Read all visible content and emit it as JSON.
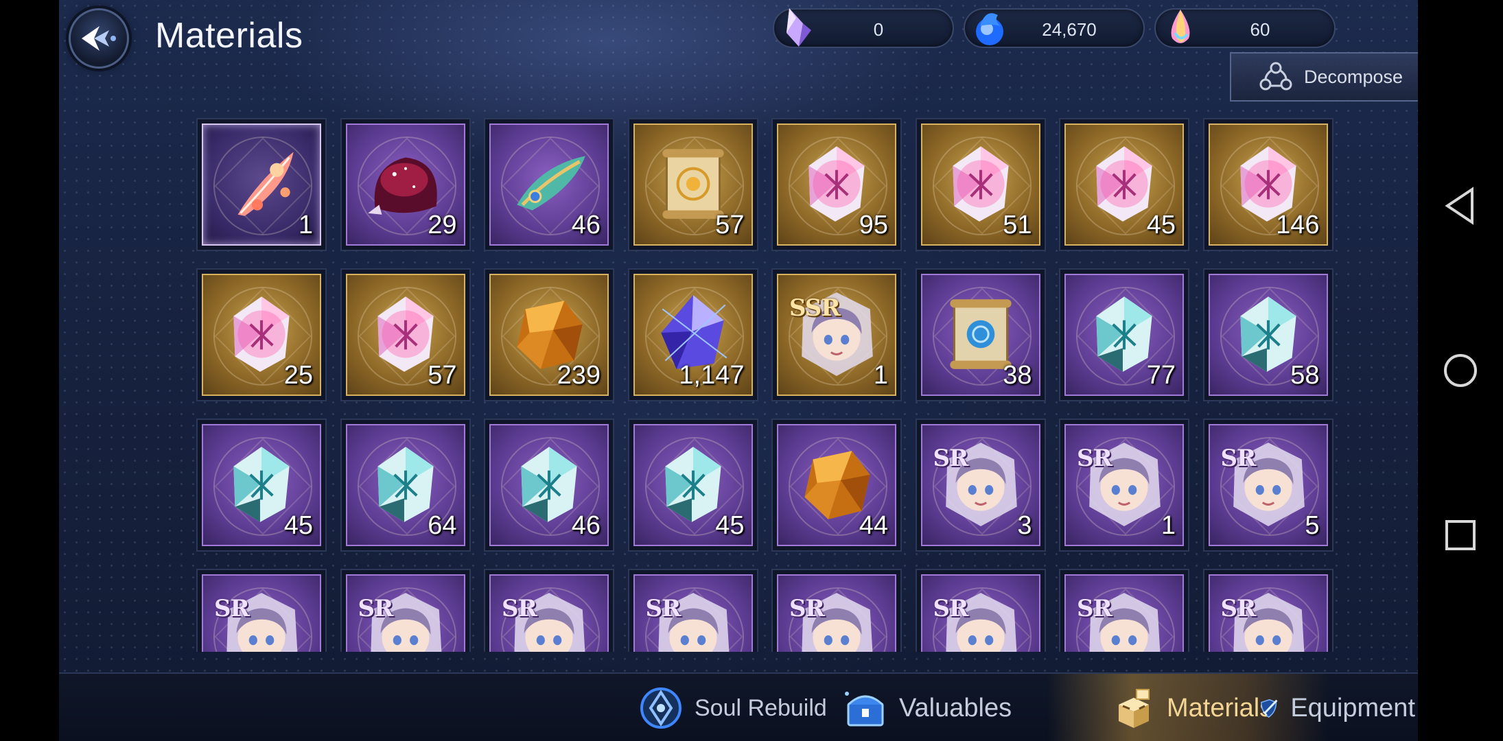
{
  "header": {
    "title": "Materials"
  },
  "currencies": [
    {
      "icon": "crystal-shard-icon",
      "value": "0",
      "color": "#c9a8ff"
    },
    {
      "icon": "blue-flame-orb-icon",
      "value": "24,670",
      "color": "#2a7cff"
    },
    {
      "icon": "rainbow-gem-icon",
      "value": "60",
      "color": "#ff9ad0"
    }
  ],
  "decompose": {
    "label": "Decompose"
  },
  "items": [
    {
      "qty": "1",
      "frame": "iri",
      "art": "phoenix-feather-icon",
      "rarity": ""
    },
    {
      "qty": "29",
      "frame": "purple",
      "art": "cosmic-slime-icon",
      "rarity": ""
    },
    {
      "qty": "46",
      "frame": "purple",
      "art": "jeweled-feather-icon",
      "rarity": ""
    },
    {
      "qty": "57",
      "frame": "gold",
      "art": "golden-scroll-icon",
      "rarity": ""
    },
    {
      "qty": "95",
      "frame": "gold",
      "art": "pink-rune-crystal-icon",
      "rarity": ""
    },
    {
      "qty": "51",
      "frame": "gold",
      "art": "pink-rune-crystal-icon",
      "rarity": ""
    },
    {
      "qty": "45",
      "frame": "gold",
      "art": "pink-rune-crystal-icon",
      "rarity": ""
    },
    {
      "qty": "146",
      "frame": "gold",
      "art": "pink-rune-crystal-icon",
      "rarity": ""
    },
    {
      "qty": "25",
      "frame": "gold",
      "art": "pink-rune-crystal-icon",
      "rarity": ""
    },
    {
      "qty": "57",
      "frame": "gold",
      "art": "pink-rune-crystal-icon",
      "rarity": ""
    },
    {
      "qty": "239",
      "frame": "gold",
      "art": "amber-ore-icon",
      "rarity": ""
    },
    {
      "qty": "1,147",
      "frame": "gold",
      "art": "violet-crystal-icon",
      "rarity": ""
    },
    {
      "qty": "1",
      "frame": "gold",
      "art": "character-shard-icon",
      "rarity": "SSR"
    },
    {
      "qty": "38",
      "frame": "purple",
      "art": "blue-seal-scroll-icon",
      "rarity": ""
    },
    {
      "qty": "77",
      "frame": "purple",
      "art": "teal-rune-crystal-icon",
      "rarity": ""
    },
    {
      "qty": "58",
      "frame": "purple",
      "art": "teal-rune-crystal-icon",
      "rarity": ""
    },
    {
      "qty": "45",
      "frame": "purple",
      "art": "teal-rune-crystal-icon",
      "rarity": ""
    },
    {
      "qty": "64",
      "frame": "purple",
      "art": "teal-rune-crystal-icon",
      "rarity": ""
    },
    {
      "qty": "46",
      "frame": "purple",
      "art": "teal-rune-crystal-icon",
      "rarity": ""
    },
    {
      "qty": "45",
      "frame": "purple",
      "art": "teal-rune-crystal-icon",
      "rarity": ""
    },
    {
      "qty": "44",
      "frame": "purple",
      "art": "amber-ore-icon",
      "rarity": ""
    },
    {
      "qty": "3",
      "frame": "purple",
      "art": "character-shard-icon",
      "rarity": "SR"
    },
    {
      "qty": "1",
      "frame": "purple",
      "art": "character-shard-icon",
      "rarity": "SR"
    },
    {
      "qty": "5",
      "frame": "purple",
      "art": "character-shard-icon",
      "rarity": "SR"
    },
    {
      "qty": "",
      "frame": "purple",
      "art": "character-shard-icon",
      "rarity": "SR"
    },
    {
      "qty": "",
      "frame": "purple",
      "art": "character-shard-icon",
      "rarity": "SR"
    },
    {
      "qty": "",
      "frame": "purple",
      "art": "character-shard-icon",
      "rarity": "SR"
    },
    {
      "qty": "",
      "frame": "purple",
      "art": "character-shard-icon",
      "rarity": "SR"
    },
    {
      "qty": "",
      "frame": "purple",
      "art": "character-shard-icon",
      "rarity": "SR"
    },
    {
      "qty": "",
      "frame": "purple",
      "art": "character-shard-icon",
      "rarity": "SR"
    },
    {
      "qty": "",
      "frame": "purple",
      "art": "character-shard-icon",
      "rarity": "SR"
    },
    {
      "qty": "",
      "frame": "purple",
      "art": "character-shard-icon",
      "rarity": "SR"
    }
  ],
  "tabs": [
    {
      "label": "Soul Rebuild",
      "icon": "soul-crest-icon",
      "active": false
    },
    {
      "label": "Valuables",
      "icon": "treasure-chest-icon",
      "active": false
    },
    {
      "label": "Materials",
      "icon": "crates-icon",
      "active": true
    },
    {
      "label": "Equipment",
      "icon": "shield-sword-icon",
      "active": false
    }
  ],
  "colors": {
    "accent_gold": "#f3d594",
    "frame_gold": "#d8b35f",
    "frame_purple": "#a07ad6"
  }
}
